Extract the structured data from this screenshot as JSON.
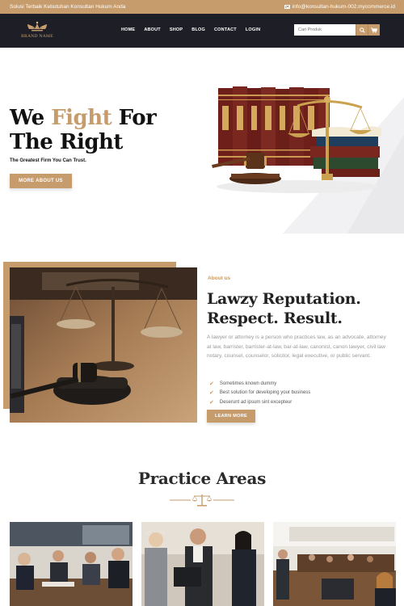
{
  "topbar": {
    "tagline": "Solusi Terbaik Kebutuhan Konsultan Hukum Anda",
    "email": "info@konsultan-hukum-002.mycommerce.id"
  },
  "header": {
    "brand": "BRAND NAME",
    "nav": [
      "HOME",
      "ABOUT",
      "SHOP",
      "BLOG",
      "CONTACT",
      "LOGIN"
    ],
    "search_placeholder": "Cari Produk"
  },
  "hero": {
    "title_part1": "We ",
    "title_highlight": "Fight",
    "title_part2": " For",
    "title_line2": "The Right",
    "subtitle": "The Greatest Firm You Can Trust.",
    "button": "MORE ABOUT US"
  },
  "about": {
    "label": "About us",
    "title_line1": "Lawzy Reputation.",
    "title_line2": "Respect. Result.",
    "text": "A lawyer or attorney is a person who practices law, as an advocate, attorney at law, barrister, barrister-at-law, bar-at-law, canonist, canon lawyer, civil law notary, counsel, counselor, solicitor, legal executive, or public servant.",
    "list": [
      "Sometimes known dummy",
      "Best solution for developing your business",
      "Deserunt ad ipsum sint excepteur"
    ],
    "button": "LEARN MORE"
  },
  "practice": {
    "title": "Practice Areas"
  },
  "colors": {
    "gold": "#c69c6d",
    "dark": "#1e1f26"
  }
}
